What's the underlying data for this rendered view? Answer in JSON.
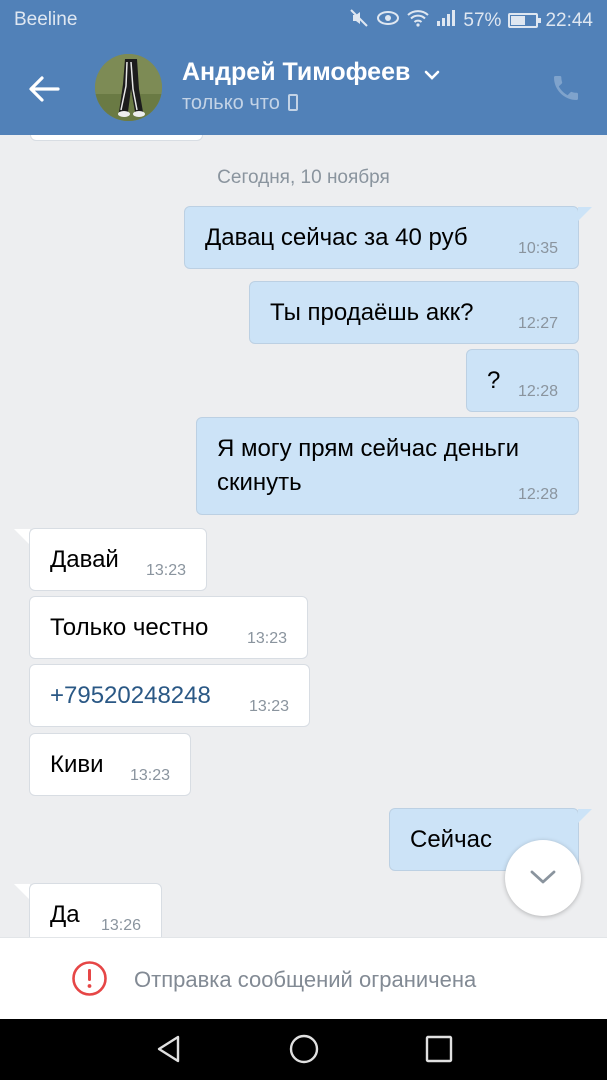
{
  "status_bar": {
    "carrier": "Beeline",
    "battery": "57%",
    "battery_level": 0.57,
    "time": "22:44",
    "icons": [
      "mute-icon",
      "eye-icon",
      "wifi-icon",
      "signal-icon",
      "battery-icon"
    ]
  },
  "header": {
    "contact_name": "Андрей Тимофеев",
    "status": "только что",
    "icons": [
      "back-arrow-icon",
      "chevron-down-icon",
      "mobile-phone-icon",
      "phone-call-icon"
    ]
  },
  "chat": {
    "date_separator": "Сегодня, 10 ноября",
    "messages": [
      {
        "direction": "out",
        "text": "Давац сейчас за 40 руб",
        "time": "10:35"
      },
      {
        "direction": "out",
        "text": "Ты продаёшь акк?",
        "time": "12:27"
      },
      {
        "direction": "out",
        "text": "?",
        "time": "12:28"
      },
      {
        "direction": "out",
        "text": "Я могу прям сейчас деньги скинуть",
        "time": "12:28"
      },
      {
        "direction": "in",
        "text": "Давай",
        "time": "13:23"
      },
      {
        "direction": "in",
        "text": "Только честно",
        "time": "13:23"
      },
      {
        "direction": "in",
        "text": "+79520248248",
        "time": "13:23",
        "is_link": true
      },
      {
        "direction": "in",
        "text": "Киви",
        "time": "13:23"
      },
      {
        "direction": "out",
        "text": "Сейчас",
        "time": ""
      },
      {
        "direction": "in",
        "text": "Да",
        "time": "13:26"
      }
    ]
  },
  "footer": {
    "restriction_text": "Отправка сообщений ограничена",
    "icons": [
      "warning-icon"
    ]
  },
  "nav_bar": {
    "icons": [
      "nav-back-icon",
      "nav-home-icon",
      "nav-recents-icon"
    ]
  },
  "colors": {
    "header_bg": "#5181b8",
    "chat_bg": "#edeef0",
    "outgoing_bubble": "#cce3f7",
    "incoming_bubble": "#ffffff",
    "link": "#2a5885",
    "warning": "#e64646"
  }
}
